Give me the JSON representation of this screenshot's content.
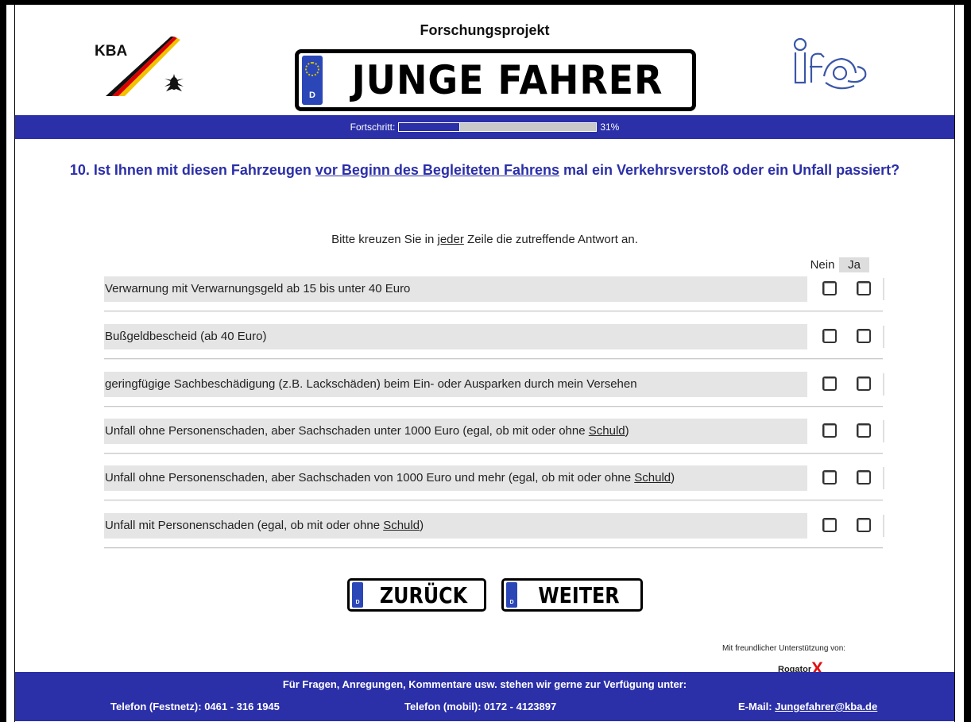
{
  "header": {
    "title": "Forschungsprojekt",
    "kba_logo_text": "KBA",
    "plate_text": "JUNGE FAHRER",
    "plate_country": "D",
    "ifas_logo_text": "ifas"
  },
  "progress": {
    "label": "Fortschritt:",
    "value": 0.31,
    "percent_text": "31%"
  },
  "question": {
    "number_prefix": "10. Ist Ihnen mit diesen Fahrzeugen ",
    "underlined": "vor Beginn des Begleiteten Fahrens",
    "suffix": " mal ein Verkehrsverstoß oder ein Unfall passiert?"
  },
  "instruction": {
    "before": "Bitte kreuzen Sie in ",
    "underlined": "jeder",
    "after": " Zeile die zutreffende Antwort an."
  },
  "columns": {
    "nein": "Nein",
    "ja": "Ja"
  },
  "rows": [
    {
      "text": "Verwarnung mit Verwarnungsgeld ab 15 bis unter 40 Euro",
      "underlined": "",
      "after": ""
    },
    {
      "text": "Bußgeldbescheid (ab 40 Euro)",
      "underlined": "",
      "after": ""
    },
    {
      "text": "geringfügige Sachbeschädigung (z.B. Lackschäden) beim Ein- oder Ausparken durch mein Versehen",
      "underlined": "",
      "after": ""
    },
    {
      "text": "Unfall ohne Personenschaden, aber Sachschaden unter 1000 Euro (egal, ob mit oder ohne ",
      "underlined": "Schuld",
      "after": ")"
    },
    {
      "text": "Unfall ohne Personenschaden, aber Sachschaden von 1000 Euro und mehr (egal, ob mit oder ohne ",
      "underlined": "Schuld",
      "after": ")"
    },
    {
      "text": "Unfall mit Personenschaden (egal, ob mit oder ohne ",
      "underlined": "Schuld",
      "after": ")"
    }
  ],
  "buttons": {
    "back": "ZURÜCK",
    "next": "WEITER",
    "plate_country": "D"
  },
  "sponsor": {
    "label": "Mit freundlicher Unterstützung von:",
    "name": "Rogator",
    "mark": "X"
  },
  "footer": {
    "line1": "Für Fragen, Anregungen, Kommentare usw. stehen wir gerne zur Verfügung unter:",
    "tel_fixed": "Telefon (Festnetz): 0461 - 316 1945",
    "tel_mobile": "Telefon (mobil): 0172 - 4123897",
    "mail_label": "E-Mail: ",
    "mail": "Jungefahrer@kba.de"
  },
  "colors": {
    "brand_blue": "#2b2fa8",
    "row_gray": "#e5e5e5"
  }
}
